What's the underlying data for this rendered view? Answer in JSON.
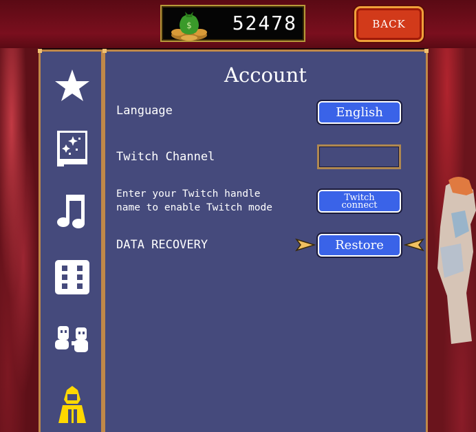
{
  "currency": {
    "value": "52478",
    "icon": "money-bag-coins-icon"
  },
  "header": {
    "back_label": "BACK"
  },
  "sidebar": {
    "tabs": [
      {
        "name": "star-icon",
        "active": false
      },
      {
        "name": "spellbook-icon",
        "active": false
      },
      {
        "name": "music-note-icon",
        "active": false
      },
      {
        "name": "dice-icon",
        "active": false
      },
      {
        "name": "characters-icon",
        "active": false
      },
      {
        "name": "hooded-figure-icon",
        "active": true
      }
    ]
  },
  "panel": {
    "title": "Account",
    "language": {
      "label": "Language",
      "value": "English"
    },
    "twitch_channel": {
      "label": "Twitch Channel",
      "value": ""
    },
    "twitch_info": {
      "text": "Enter your Twitch handle\nname to enable Twitch mode",
      "button_line1": "Twitch",
      "button_line2": "connect"
    },
    "data_recovery": {
      "label": "DATA RECOVERY",
      "button": "Restore"
    }
  },
  "colors": {
    "panel": "#454a7c",
    "border": "#c08848",
    "button": "#3a63e8",
    "back": "#d23a1a",
    "active_tab": "#ffd800"
  }
}
